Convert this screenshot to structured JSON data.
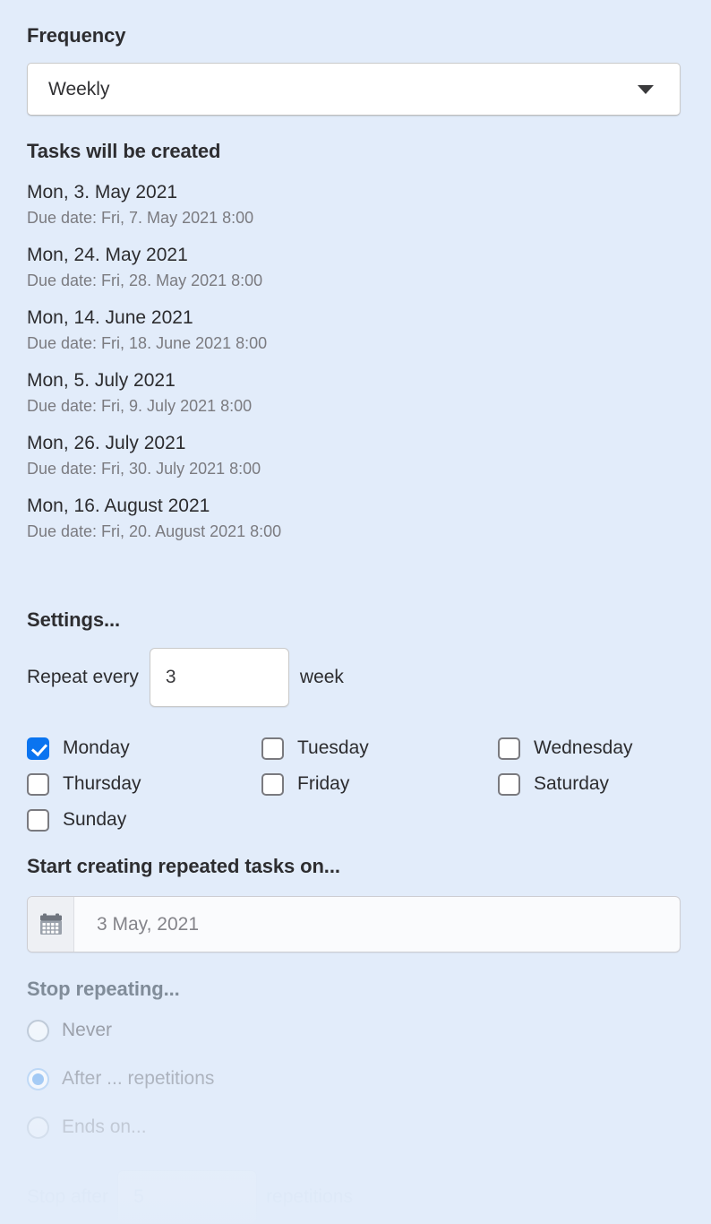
{
  "colors": {
    "background": "#e2ecfa",
    "accent_blue": "#0a74f0",
    "faded_blue": "#7cb5f2",
    "heading": "#2d2d30",
    "muted_text": "#7b7b80"
  },
  "frequency": {
    "label": "Frequency",
    "selected": "Weekly",
    "arrow_icon": "chevron-down-icon"
  },
  "tasks": {
    "label": "Tasks will be created",
    "items": [
      {
        "date": "Mon, 3. May 2021",
        "due": "Due date: Fri, 7. May 2021 8:00"
      },
      {
        "date": "Mon, 24. May 2021",
        "due": "Due date: Fri, 28. May 2021 8:00"
      },
      {
        "date": "Mon, 14. June 2021",
        "due": "Due date: Fri, 18. June 2021 8:00"
      },
      {
        "date": "Mon, 5. July 2021",
        "due": "Due date: Fri, 9. July 2021 8:00"
      },
      {
        "date": "Mon, 26. July 2021",
        "due": "Due date: Fri, 30. July 2021 8:00"
      },
      {
        "date": "Mon, 16. August 2021",
        "due": "Due date: Fri, 20. August 2021 8:00"
      }
    ]
  },
  "settings": {
    "label": "Settings...",
    "repeat_prefix": "Repeat every",
    "repeat_value": "3",
    "repeat_suffix": "week"
  },
  "weekdays": [
    {
      "label": "Monday",
      "checked": true,
      "col": 0,
      "row": 0
    },
    {
      "label": "Tuesday",
      "checked": false,
      "col": 1,
      "row": 0
    },
    {
      "label": "Wednesday",
      "checked": false,
      "col": 2,
      "row": 0
    },
    {
      "label": "Thursday",
      "checked": false,
      "col": 0,
      "row": 1
    },
    {
      "label": "Friday",
      "checked": false,
      "col": 1,
      "row": 1
    },
    {
      "label": "Saturday",
      "checked": false,
      "col": 2,
      "row": 1
    },
    {
      "label": "Sunday",
      "checked": false,
      "col": 0,
      "row": 2
    }
  ],
  "start_on": {
    "label": "Start creating repeated tasks on...",
    "value": "3 May, 2021",
    "icon": "calendar-icon"
  },
  "stop_repeating": {
    "label": "Stop repeating...",
    "options": [
      {
        "label": "Never",
        "selected": false
      },
      {
        "label": "After ... repetitions",
        "selected": true
      },
      {
        "label": "Ends on...",
        "selected": false
      }
    ],
    "stop_after_prefix": "Stop after",
    "stop_after_value": "5",
    "stop_after_suffix": "repetitions"
  }
}
